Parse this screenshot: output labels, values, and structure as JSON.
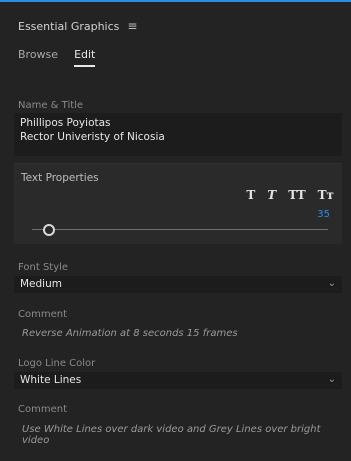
{
  "header": {
    "title": "Essential Graphics",
    "menu_icon": "hamburger-icon"
  },
  "tabs": [
    {
      "label": "Browse"
    },
    {
      "label": "Edit"
    }
  ],
  "name_title": {
    "label": "Name & Title",
    "lines": [
      "Phillipos Poyiotas",
      "Rector Univeristy of Nicosia"
    ]
  },
  "text_properties": {
    "label": "Text Properties",
    "styles": [
      "T",
      "T",
      "TT",
      "Tт"
    ],
    "slider_value": "35"
  },
  "font_style": {
    "label": "Font Style",
    "value": "Medium"
  },
  "comment_1": {
    "label": "Comment",
    "text": "Reverse Animation at 8 seconds 15 frames"
  },
  "logo_line_color": {
    "label": "Logo Line Color",
    "value": "White Lines"
  },
  "comment_2": {
    "label": "Comment",
    "text": "Use White Lines over dark video and Grey Lines over bright video"
  },
  "colors": {
    "accent": "#2d8ceb",
    "panel": "#232323",
    "field": "#1c1c1c"
  }
}
